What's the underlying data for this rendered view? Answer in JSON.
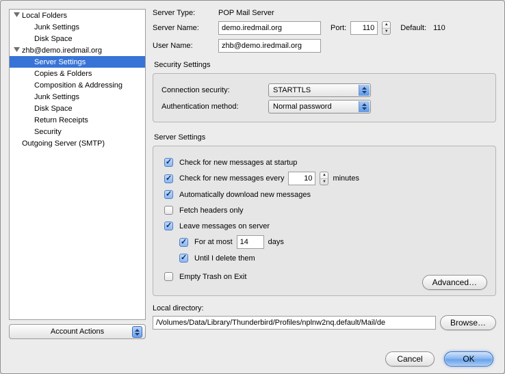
{
  "sidebar": {
    "tree": [
      {
        "label": "Local Folders",
        "expandable": true
      },
      {
        "label": "Junk Settings",
        "indent": 1
      },
      {
        "label": "Disk Space",
        "indent": 1
      },
      {
        "label": "zhb@demo.iredmail.org",
        "expandable": true
      },
      {
        "label": "Server Settings",
        "indent": 1,
        "selected": true
      },
      {
        "label": "Copies & Folders",
        "indent": 1
      },
      {
        "label": "Composition & Addressing",
        "indent": 1
      },
      {
        "label": "Junk Settings",
        "indent": 1
      },
      {
        "label": "Disk Space",
        "indent": 1
      },
      {
        "label": "Return Receipts",
        "indent": 1
      },
      {
        "label": "Security",
        "indent": 1
      },
      {
        "label": "Outgoing Server (SMTP)"
      }
    ],
    "account_actions": "Account Actions"
  },
  "top": {
    "server_type_label": "Server Type:",
    "server_type_value": "POP Mail Server",
    "server_name_label": "Server Name:",
    "server_name_value": "demo.iredmail.org",
    "port_label": "Port:",
    "port_value": "110",
    "default_label": "Default:",
    "default_value": "110",
    "user_name_label": "User Name:",
    "user_name_value": "zhb@demo.iredmail.org"
  },
  "security": {
    "title": "Security Settings",
    "conn_label": "Connection security:",
    "conn_value": "STARTTLS",
    "auth_label": "Authentication method:",
    "auth_value": "Normal password"
  },
  "server_settings": {
    "title": "Server Settings",
    "check_startup": "Check for new messages at startup",
    "check_every_pre": "Check for new messages every",
    "check_every_value": "10",
    "check_every_post": "minutes",
    "auto_download": "Automatically download new messages",
    "fetch_headers": "Fetch headers only",
    "leave_on_server": "Leave messages on server",
    "for_at_most_pre": "For at most",
    "for_at_most_value": "14",
    "for_at_most_post": "days",
    "until_delete": "Until I delete them",
    "empty_trash": "Empty Trash on Exit",
    "advanced": "Advanced…"
  },
  "local_dir": {
    "label": "Local directory:",
    "value": "/Volumes/Data/Library/Thunderbird/Profiles/nplnw2nq.default/Mail/de",
    "browse": "Browse…"
  },
  "buttons": {
    "cancel": "Cancel",
    "ok": "OK"
  }
}
